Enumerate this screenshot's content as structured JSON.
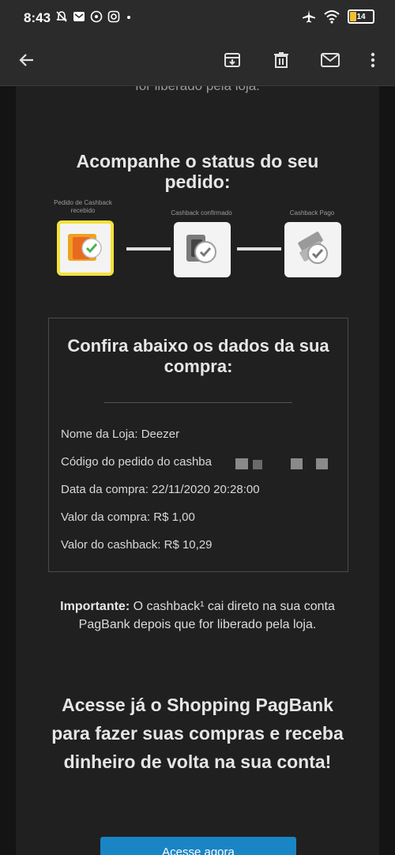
{
  "status_bar": {
    "time": "8:43",
    "battery": "14",
    "left_icons": [
      "mute-icon",
      "mail-icon",
      "whatsapp-icon",
      "instagram-icon",
      "dot-icon"
    ],
    "right_icons": [
      "airplane-icon",
      "wifi-icon",
      "battery-icon"
    ]
  },
  "toolbar": {
    "icons": [
      "back-arrow-icon",
      "archive-icon",
      "trash-icon",
      "mail-icon",
      "more-vert-icon"
    ]
  },
  "email": {
    "cut_top_text": "for liberado pela loja.",
    "track_title": "Acompanhe o status do seu pedido:",
    "steps": [
      {
        "label": "Pedido de Cashback recebido",
        "active": true
      },
      {
        "label": "Cashback confirmado",
        "active": false
      },
      {
        "label": "Cashback Pago",
        "active": false
      }
    ],
    "details_title": "Confira abaixo os dados da sua compra:",
    "rows": [
      "Nome da Loja: Deezer",
      "Código do pedido do cashba",
      "Data da compra: 22/11/2020 20:28:00",
      "Valor da compra: R$ 1,00",
      "Valor do cashback: R$ 10,29"
    ],
    "important_label": "Importante:",
    "important_text": " O cashback¹ cai direto na sua conta PagBank depois que for liberado pela loja.",
    "cta_text": "Acesse já o Shopping PagBank para fazer suas compras e receba dinheiro de volta na sua conta!",
    "button_label": "Acesse agora"
  },
  "colors": {
    "accent_yellow": "#f5e13a",
    "button_blue": "#1a85c4",
    "background": "#202020"
  }
}
